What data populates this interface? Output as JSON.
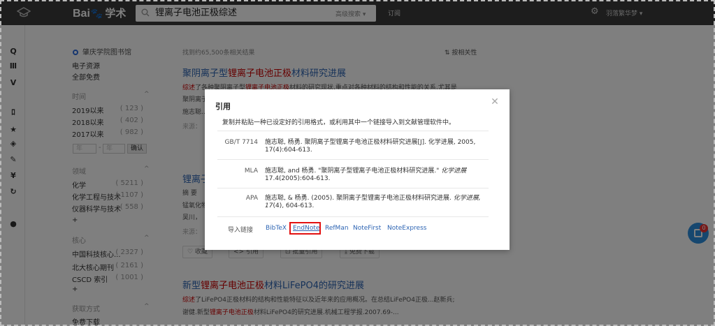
{
  "header": {
    "logo_prefix": "Bai",
    "logo_suffix": "学术",
    "search_query": "锂离子电池正极综述",
    "advanced_search": "高级搜索 ▾",
    "subscribe": "订阅",
    "user": "羽落繁华梦 ▾"
  },
  "rail": {
    "icons": [
      "search-icon",
      "library-icon",
      "v-icon",
      "feed-icon",
      "star-icon",
      "layers-icon",
      "pen-icon",
      "yen-icon",
      "refresh-icon",
      "user-icon"
    ]
  },
  "filters": {
    "library": "肇庆学院图书馆",
    "resource_1": "电子资源",
    "resource_2": "全部免费",
    "time_heading": "时间",
    "time_items": [
      {
        "label": "2019以来",
        "count": "( 123 )"
      },
      {
        "label": "2018以来",
        "count": "( 402 )"
      },
      {
        "label": "2017以来",
        "count": "( 982 )"
      }
    ],
    "year_from": "年",
    "year_to": "年",
    "confirm": "确认",
    "field_heading": "领域",
    "field_items": [
      {
        "label": "化学",
        "count": "( 5211 )"
      },
      {
        "label": "化学工程与技术",
        "count": "( 1107 )"
      },
      {
        "label": "仪器科学与技术",
        "count": "( 558 )"
      }
    ],
    "plus": "+",
    "core_heading": "核心",
    "core_items": [
      {
        "label": "中国科技核心...",
        "count": "( 2327 )"
      },
      {
        "label": "北大核心期刊",
        "count": "( 2161 )"
      },
      {
        "label": "CSCD 索引",
        "count": "( 1001 )"
      }
    ],
    "access_heading": "获取方式",
    "access_item": "免费下载"
  },
  "results": {
    "count": "找到约65,500条相关结果",
    "sort": "⇅ 按相关性",
    "r1_title_a": "聚阴离子型",
    "r1_title_hl": "锂离子电池正极",
    "r1_title_b": "材料研究进展",
    "r1_snip_a": "综述",
    "r1_snip_b": "了各种聚阴离子型",
    "r1_snip_hl": "锂离子电池正极",
    "r1_snip_c": "材料的研究现状,重点对各种材料的结构和性能的关系,尤其是",
    "r1_line2": "聚阴离子...",
    "r1_line3": "施志聪...",
    "r1_source": "来源：",
    "r2_title": "锂离子",
    "r2_snip": "摘 要",
    "r2_line2": "锰氧化物",
    "r2_line3": "吴川，",
    "r2_source": "来源：",
    "actions": [
      "♡ 收藏",
      "<> 引用",
      "⊡ 批量引用",
      "⤓ 免费下载"
    ],
    "r3_title_a": "新型",
    "r3_title_hl": "锂离子电池正极",
    "r3_title_b": "材料LiFePO4的研究进展",
    "r3_snip_a": "综述",
    "r3_snip_b": "了LiFePO4正极材料的结构和性能特征以及近年来的应用概况。在总结LiFePO4正极...赵新兵;",
    "r3_line2_a": "谢健.新型",
    "r3_line2_hl": "锂离子电池正极",
    "r3_line2_b": "材料LiFePO4的研究进展.机械工程学报.2007.69-..."
  },
  "float_badge": "0",
  "modal": {
    "title": "引用",
    "close": "✕",
    "description": "复制并粘贴一种已设定好的引用格式，或利用其中一个链接导入到文献管理软件中。",
    "gbt_label": "GB/T 7714",
    "gbt_text": "施志聪, 杨勇. 聚阴离子型锂离子电池正极材料研究进展[J]. 化学进展, 2005, 17(4):604-613.",
    "mla_label": "MLA",
    "mla_text_a": "施志聪, and 杨勇. \"聚阴离子型锂离子电池正极材料研究进展.\" ",
    "mla_text_i": "化学进展",
    "mla_text_b": " 17.4(2005):604-613.",
    "apa_label": "APA",
    "apa_text_a": "施志聪, & 杨勇. (2005). 聚阴离子型锂离子电池正极材料研究进展. ",
    "apa_text_i": "化学进展, 17",
    "apa_text_b": "(4), 604-613.",
    "import_label": "导入链接",
    "links": [
      "BibTeX",
      "EndNote",
      "RefMan",
      "NoteFirst",
      "NoteExpress"
    ],
    "highlight_color": "#e21111"
  }
}
